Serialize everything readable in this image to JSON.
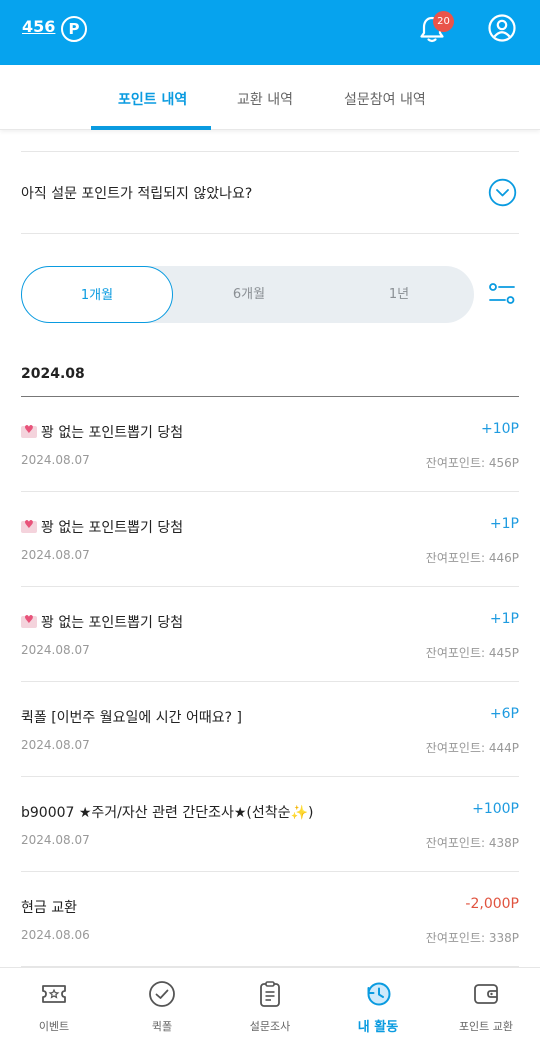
{
  "header": {
    "points": "456",
    "points_badge": "P",
    "notification_count": "20"
  },
  "tabs": [
    {
      "label": "포인트 내역",
      "active": true
    },
    {
      "label": "교환 내역",
      "active": false
    },
    {
      "label": "설문참여 내역",
      "active": false
    }
  ],
  "faq": {
    "question": "아직 설문 포인트가 적립되지 않았나요?"
  },
  "period": {
    "options": [
      "1개월",
      "6개월",
      "1년"
    ],
    "selected": "1개월"
  },
  "month_label": "2024.08",
  "transactions": [
    {
      "icon": "heart-letter-icon",
      "title": "꽝 없는 포인트뽑기 당첨",
      "date": "2024.08.07",
      "amount": "+10P",
      "balance": "잔여포인트: 456P"
    },
    {
      "icon": "heart-letter-icon",
      "title": "꽝 없는 포인트뽑기 당첨",
      "date": "2024.08.07",
      "amount": "+1P",
      "balance": "잔여포인트: 446P"
    },
    {
      "icon": "heart-letter-icon",
      "title": "꽝 없는 포인트뽑기 당첨",
      "date": "2024.08.07",
      "amount": "+1P",
      "balance": "잔여포인트: 445P"
    },
    {
      "title": "퀵폴 [이번주 월요일에 시간 어때요? ]",
      "date": "2024.08.07",
      "amount": "+6P",
      "balance": "잔여포인트: 444P"
    },
    {
      "title": "b90007 ★주거/자산 관련 간단조사★(선착순",
      "title_suffix": ")",
      "date": "2024.08.07",
      "amount": "+100P",
      "balance": "잔여포인트: 438P"
    },
    {
      "title": "현금 교환",
      "date": "2024.08.06",
      "amount": "-2,000P",
      "balance": "잔여포인트: 338P"
    }
  ],
  "bottom_nav": [
    {
      "label": "이벤트",
      "icon": "event-ticket-icon",
      "active": false
    },
    {
      "label": "퀵폴",
      "icon": "check-circle-icon",
      "active": false
    },
    {
      "label": "설문조사",
      "icon": "clipboard-icon",
      "active": false
    },
    {
      "label": "내 활동",
      "icon": "history-clock-icon",
      "active": true
    },
    {
      "label": "포인트 교환",
      "icon": "wallet-icon",
      "active": false
    }
  ],
  "colors": {
    "brand": "#06A3EE",
    "accent": "#0A9BE0",
    "positive": "#1E9BE0",
    "negative": "#E0533F",
    "badge": "#E9544A"
  }
}
